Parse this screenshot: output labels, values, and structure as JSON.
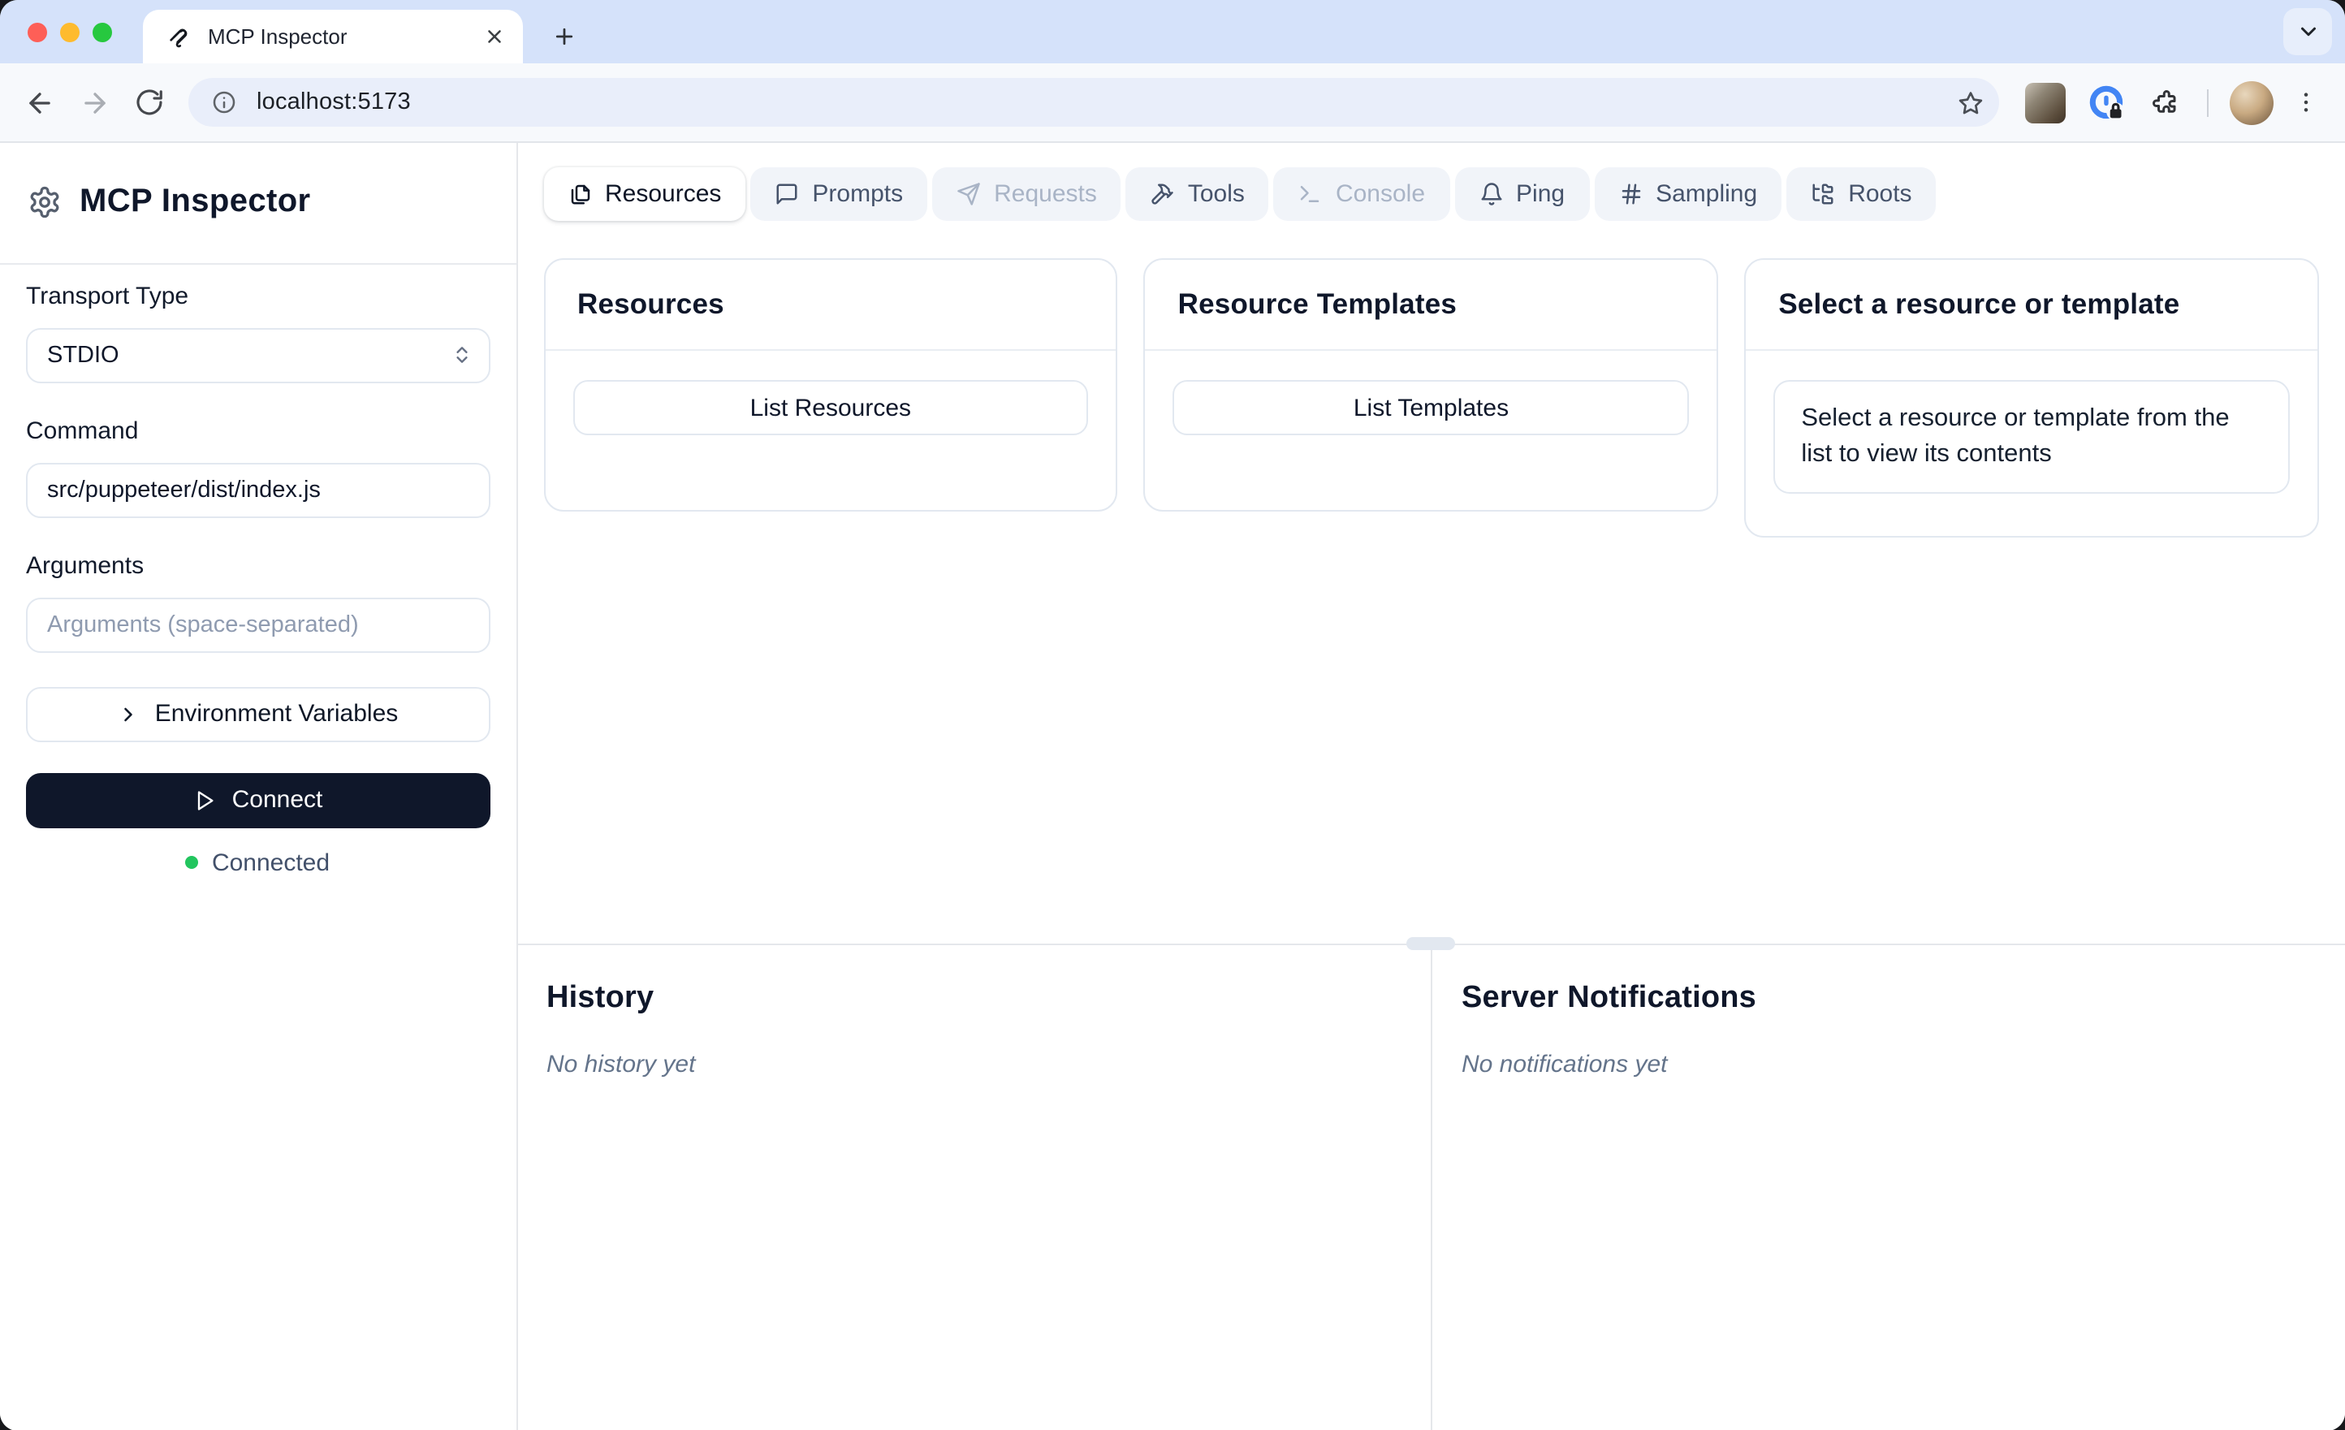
{
  "browser": {
    "tab_title": "MCP Inspector",
    "url": "localhost:5173"
  },
  "sidebar": {
    "title": "MCP Inspector",
    "transport": {
      "label": "Transport Type",
      "value": "STDIO"
    },
    "command": {
      "label": "Command",
      "value": "src/puppeteer/dist/index.js"
    },
    "arguments": {
      "label": "Arguments",
      "placeholder": "Arguments (space-separated)"
    },
    "env_button": "Environment Variables",
    "connect_button": "Connect",
    "status": {
      "label": "Connected",
      "color": "#22c55e"
    }
  },
  "tabs": [
    {
      "label": "Resources",
      "icon": "files-icon",
      "state": "active"
    },
    {
      "label": "Prompts",
      "icon": "message-square-icon",
      "state": "enabled"
    },
    {
      "label": "Requests",
      "icon": "send-icon",
      "state": "disabled"
    },
    {
      "label": "Tools",
      "icon": "hammer-icon",
      "state": "enabled"
    },
    {
      "label": "Console",
      "icon": "terminal-icon",
      "state": "disabled"
    },
    {
      "label": "Ping",
      "icon": "bell-icon",
      "state": "enabled"
    },
    {
      "label": "Sampling",
      "icon": "hash-icon",
      "state": "enabled"
    },
    {
      "label": "Roots",
      "icon": "folder-tree-icon",
      "state": "enabled"
    }
  ],
  "panels": {
    "resources": {
      "title": "Resources",
      "button": "List Resources"
    },
    "templates": {
      "title": "Resource Templates",
      "button": "List Templates"
    },
    "preview": {
      "title": "Select a resource or template",
      "message": "Select a resource or template from the list to view its contents"
    }
  },
  "history": {
    "title": "History",
    "empty": "No history yet"
  },
  "notifications": {
    "title": "Server Notifications",
    "empty": "No notifications yet"
  },
  "colors": {
    "connect_button_bg": "#0f172a",
    "status_green": "#22c55e",
    "chrome_tabstrip": "#d5e2fa",
    "tab_tile_bg": "#f1f4f9",
    "border": "#e2e8f0"
  }
}
